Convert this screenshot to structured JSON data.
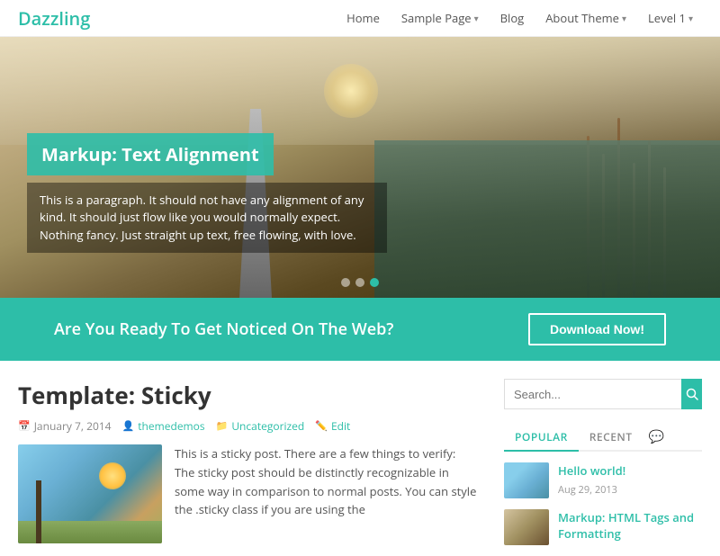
{
  "site": {
    "logo": "Dazzling"
  },
  "nav": {
    "items": [
      {
        "label": "Home",
        "hasDropdown": false
      },
      {
        "label": "Sample Page",
        "hasDropdown": true
      },
      {
        "label": "Blog",
        "hasDropdown": false
      },
      {
        "label": "About Theme",
        "hasDropdown": true
      },
      {
        "label": "Level 1",
        "hasDropdown": true
      }
    ]
  },
  "hero": {
    "caption_title": "Markup: Text Alignment",
    "caption_text": "This is a paragraph. It should not have any alignment of any kind. It should just flow like you would normally expect. Nothing fancy. Just straight up text, free flowing, with love.",
    "dots": [
      1,
      2,
      3
    ],
    "active_dot": 2
  },
  "cta": {
    "text": "Are You Ready To Get Noticed On The Web?",
    "button_label": "Download Now!"
  },
  "post": {
    "title": "Template: Sticky",
    "date": "January 7, 2014",
    "author": "themedemos",
    "category": "Uncategorized",
    "edit_label": "Edit",
    "excerpt": "This is a sticky post. There are a few things to verify: The sticky post should be distinctly recognizable in some way in comparison to normal posts. You can style the .sticky class if you are using the"
  },
  "sidebar": {
    "search_placeholder": "Search...",
    "search_button_label": "🔍",
    "tabs": [
      {
        "label": "POPULAR",
        "active": true
      },
      {
        "label": "RECENT",
        "active": false
      }
    ],
    "recent_posts": [
      {
        "title": "Hello world!",
        "date": "Aug 29, 2013",
        "thumb_class": "recent-thumb-1"
      },
      {
        "title": "Markup: HTML Tags and Formatting",
        "date": "",
        "thumb_class": "recent-thumb-2"
      }
    ]
  }
}
